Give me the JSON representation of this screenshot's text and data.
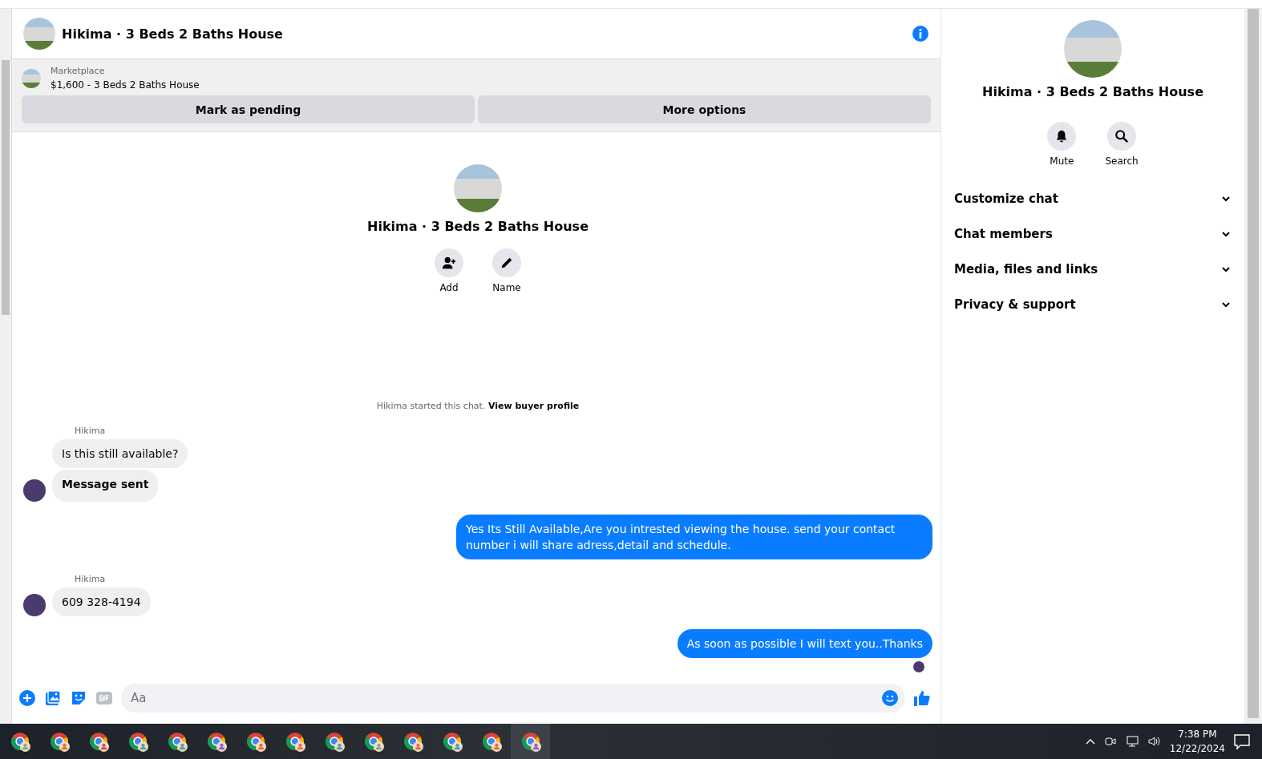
{
  "header": {
    "title": "Hikima · 3 Beds 2 Baths House"
  },
  "listing": {
    "source": "Marketplace",
    "summary": "$1,600 - 3 Beds 2 Baths House",
    "buttons": [
      "Mark as pending",
      "More options"
    ]
  },
  "intro": {
    "title": "Hikima · 3 Beds 2 Baths House",
    "actions": [
      {
        "kind": "add",
        "label": "Add"
      },
      {
        "kind": "name",
        "label": "Name"
      }
    ],
    "notice": "Hikima started this chat. **View buyer profile**"
  },
  "messages": [
    {
      "kind": "incoming",
      "sender": "Hikima",
      "bubbles": [
        {
          "text": "Is this still available?",
          "bold": false
        },
        {
          "text": "Message sent",
          "bold": true
        }
      ]
    },
    {
      "kind": "outgoing",
      "bubbles": [
        {
          "text": "Yes Its Still Available,Are you intrested viewing the house. send your contact number i will share adress,detail and schedule.",
          "bold": false
        }
      ]
    },
    {
      "kind": "incoming",
      "sender": "Hikima",
      "bubbles": [
        {
          "text": "609 328-4194",
          "bold": false
        }
      ]
    },
    {
      "kind": "outgoing",
      "bubbles": [
        {
          "text": "As soon as possible I will text you..Thanks",
          "bold": false
        }
      ],
      "seen": true
    }
  ],
  "composer": {
    "placeholder": "Aa"
  },
  "details": {
    "title": "Hikima · 3 Beds 2 Baths House",
    "actions": [
      {
        "kind": "mute",
        "label": "Mute"
      },
      {
        "kind": "search",
        "label": "Search"
      }
    ],
    "sections": [
      {
        "label": "Customize chat",
        "expanded": false
      },
      {
        "label": "Chat members",
        "expanded": false
      },
      {
        "label": "Media, files and links",
        "expanded": false
      },
      {
        "label": "Privacy & support",
        "expanded": false
      }
    ]
  },
  "taskbar": {
    "apps": [
      {
        "color": "#7fb37f",
        "selected": false
      },
      {
        "color": "#e2733a",
        "selected": false
      },
      {
        "color": "#e04b4b",
        "selected": false
      },
      {
        "color": "#4aa3a8",
        "selected": false
      },
      {
        "color": "#4aa3a8",
        "selected": false
      },
      {
        "color": "#8e5fd0",
        "selected": false
      },
      {
        "color": "#e2733a",
        "selected": false
      },
      {
        "color": "#e2733a",
        "selected": false
      },
      {
        "color": "#4aa3a8",
        "selected": false
      },
      {
        "color": "#7fb37f",
        "selected": false
      },
      {
        "color": "#e2733a",
        "selected": false
      },
      {
        "color": "#4aa3a8",
        "selected": false
      },
      {
        "color": "#e2733a",
        "selected": false
      },
      {
        "color": "#8e5fd0",
        "selected": true
      }
    ],
    "time": "7:38 PM",
    "date": "12/22/2024"
  }
}
